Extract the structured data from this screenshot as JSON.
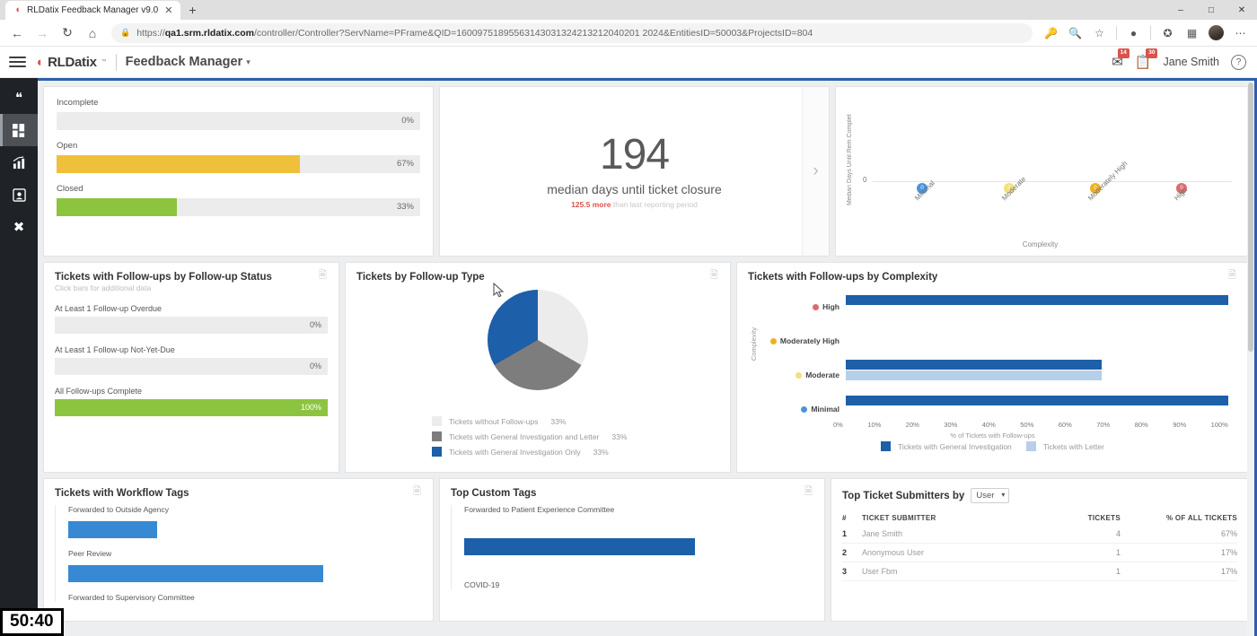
{
  "browser": {
    "tab": {
      "title": "RLDatix Feedback Manager v9.0",
      "favicon_icon": "rldatix-favicon",
      "close_icon": "close-icon"
    },
    "new_tab_label": "+",
    "window_controls": {
      "minimize": "–",
      "maximize": "□",
      "close": "✕"
    },
    "nav": {
      "back": "←",
      "forward": "→",
      "reload": "↻",
      "home": "⌂"
    },
    "url": {
      "lock_icon": "lock-icon",
      "scheme": "https://",
      "host": "qa1.srm.rldatix.com",
      "path": "/controller/Controller?ServName=PFrame&QID=16009751895563143031324213212040201 2024&EntitiesID=50003&ProjectsID=804",
      "full": "https://qa1.srm.rldatix.com/controller/Controller?ServName=PFrame&QID=16009751895563143031324213212040201 2024&EntitiesID=50003&ProjectsID=804"
    },
    "toolbar_icons": [
      "key-icon",
      "zoom-search-icon",
      "favorite-star-icon",
      "browser-essentials-icon",
      "collections-star-icon",
      "extensions-icon",
      "profile-avatar",
      "more-options-icon"
    ]
  },
  "app_header": {
    "menu_icon": "hamburger-menu-icon",
    "brand": "RLDatix",
    "brand_tm": "™",
    "app_name": "Feedback Manager",
    "dropdown_icon": "chevron-down-icon",
    "mail_badge": "14",
    "task_badge": "30",
    "user_name": "Jane Smith",
    "help_icon": "help-icon"
  },
  "sidebar": {
    "items": [
      {
        "name": "feedback",
        "icon": "quote-icon",
        "glyph": "❝",
        "active": false
      },
      {
        "name": "dashboard",
        "icon": "dashboard-grid-icon",
        "glyph": "▦",
        "active": true
      },
      {
        "name": "reports",
        "icon": "bar-chart-icon",
        "glyph": "ᴵ",
        "active": false
      },
      {
        "name": "library",
        "icon": "image-box-icon",
        "glyph": "▣",
        "active": false
      },
      {
        "name": "tools",
        "icon": "tools-icon",
        "glyph": "⚒",
        "active": false
      }
    ]
  },
  "timer": "50:40",
  "cards": {
    "ticket_status": {
      "export_icon": "export-icon",
      "chart_data": {
        "type": "bar",
        "title": "",
        "orientation": "horizontal",
        "categories": [
          "Incomplete",
          "Open",
          "Closed"
        ],
        "values": [
          0,
          67,
          33
        ],
        "labels": [
          "0%",
          "67%",
          "33%"
        ],
        "colors": [
          "#ececec",
          "#efc13a",
          "#8dc43f"
        ],
        "xlabel": "",
        "ylabel": "",
        "xlim": [
          0,
          100
        ]
      }
    },
    "kpi": {
      "value": "194",
      "label": "median days until ticket closure",
      "delta_value": "125.5 more",
      "delta_suffix": "than last reporting period",
      "next_arrow": "chevron-right-icon"
    },
    "median_days_scatter": {
      "export_icon": "export-icon",
      "chart_data": {
        "type": "scatter",
        "title": "",
        "ylabel": "Median Days Until Rem Complet",
        "xlabel": "Complexity",
        "categories": [
          "Minimal",
          "Moderate",
          "Moderately High",
          "High"
        ],
        "values": [
          0,
          0,
          0,
          0
        ],
        "point_labels": [
          "0",
          "0",
          "0",
          "0"
        ],
        "colors": [
          "#4d93d9",
          "#f2e07a",
          "#edb11f",
          "#dc6b6b"
        ],
        "ytick_labels": [
          "0"
        ],
        "ylim": [
          0,
          1
        ]
      }
    },
    "followup_status": {
      "title": "Tickets with Follow-ups by Follow-up Status",
      "subtitle": "Click bars for additional data",
      "export_icon": "export-icon",
      "chart_data": {
        "type": "bar",
        "orientation": "horizontal",
        "categories": [
          "At Least 1 Follow-up Overdue",
          "At Least 1 Follow-up Not-Yet-Due",
          "All Follow-ups Complete"
        ],
        "values": [
          0,
          0,
          100
        ],
        "labels": [
          "0%",
          "0%",
          "100%"
        ],
        "colors": [
          "#ececec",
          "#ececec",
          "#8dc43f"
        ],
        "xlim": [
          0,
          100
        ]
      }
    },
    "followup_type": {
      "title": "Tickets by Follow-up Type",
      "export_icon": "export-icon",
      "chart_data": {
        "type": "pie",
        "labels": [
          "Tickets without Follow-ups",
          "Tickets with General Investigation and Letter",
          "Tickets with General Investigation Only"
        ],
        "values": [
          33,
          33,
          33
        ],
        "value_labels": [
          "33%",
          "33%",
          "33%"
        ],
        "colors": [
          "#ececec",
          "#7d7d7d",
          "#1d5fa8"
        ],
        "legend_position": "bottom"
      }
    },
    "followup_complexity": {
      "title": "Tickets with Follow-ups by Complexity",
      "export_icon": "export-icon",
      "chart_data": {
        "type": "bar",
        "orientation": "horizontal",
        "categories": [
          "High",
          "Moderately High",
          "Moderate",
          "Minimal"
        ],
        "category_dot_colors": [
          "#dc6b6b",
          "#edb11f",
          "#f2e07a",
          "#4d93d9"
        ],
        "series": [
          {
            "name": "Tickets with General Investigation",
            "values": [
              100,
              0,
              67,
              100
            ],
            "color": "#1d5fa8"
          },
          {
            "name": "Tickets with Letter",
            "values": [
              0,
              0,
              67,
              0
            ],
            "color": "#b7cfe8"
          }
        ],
        "xlabel": "% of Tickets with Follow-ups",
        "ylabel": "Complexity",
        "xtick_labels": [
          "0%",
          "10%",
          "20%",
          "30%",
          "40%",
          "50%",
          "60%",
          "70%",
          "80%",
          "90%",
          "100%"
        ],
        "xlim": [
          0,
          100
        ],
        "legend_position": "bottom"
      }
    },
    "workflow_tags": {
      "title": "Tickets with Workflow Tags",
      "export_icon": "export-icon",
      "chart_data": {
        "type": "bar",
        "orientation": "horizontal",
        "categories": [
          "Forwarded to Outside Agency",
          "Peer Review",
          "Forwarded to Supervisory Committee"
        ],
        "values": [
          25,
          72,
          0
        ],
        "colors": [
          "#3789d4",
          "#3789d4",
          "#3789d4"
        ],
        "xlim": [
          0,
          100
        ]
      }
    },
    "custom_tags": {
      "title": "Top Custom Tags",
      "export_icon": "export-icon",
      "chart_data": {
        "type": "bar",
        "orientation": "horizontal",
        "categories": [
          "Forwarded to Patient Experience Committee",
          "COVID-19"
        ],
        "values": [
          66,
          0
        ],
        "colors": [
          "#1d5fa8",
          "#1d5fa8"
        ],
        "xlim": [
          0,
          100
        ]
      }
    },
    "top_submitters": {
      "title": "Top Ticket Submitters by",
      "select_value": "User",
      "select_icon": "chevron-down-icon",
      "columns": [
        "#",
        "TICKET SUBMITTER",
        "TICKETS",
        "% OF ALL TICKETS"
      ],
      "rows": [
        {
          "rank": "1",
          "submitter": "Jane Smith",
          "tickets": "4",
          "pct": "67%"
        },
        {
          "rank": "2",
          "submitter": "Anonymous User",
          "tickets": "1",
          "pct": "17%"
        },
        {
          "rank": "3",
          "submitter": "User Fbm",
          "tickets": "1",
          "pct": "17%"
        }
      ]
    }
  }
}
